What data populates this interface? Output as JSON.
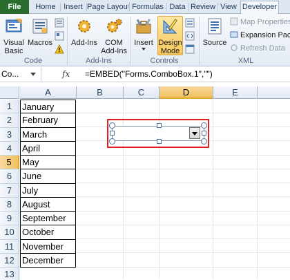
{
  "tabs": [
    {
      "label": "File"
    },
    {
      "label": "Home"
    },
    {
      "label": "Insert"
    },
    {
      "label": "Page Layout"
    },
    {
      "label": "Formulas"
    },
    {
      "label": "Data"
    },
    {
      "label": "Review"
    },
    {
      "label": "View"
    },
    {
      "label": "Developer"
    }
  ],
  "ribbon": {
    "code": {
      "visual_basic": "Visual\nBasic",
      "macros": "Macros",
      "label": "Code"
    },
    "addins": {
      "add_ins": "Add-Ins",
      "com_add_ins": "COM\nAdd-Ins",
      "label": "Add-Ins"
    },
    "controls": {
      "insert": "Insert",
      "design_mode": "Design\nMode",
      "label": "Controls"
    },
    "xml": {
      "source": "Source",
      "map_properties": "Map Properties",
      "expansion_packs": "Expansion Packs",
      "refresh_data": "Refresh Data",
      "label": "XML"
    }
  },
  "formula_bar": {
    "name_box": "Co...",
    "fx": "fx",
    "formula": "=EMBED(\"Forms.ComboBox.1\",\"\")"
  },
  "columns": [
    "A",
    "B",
    "C",
    "D",
    "E"
  ],
  "selected_column": "D",
  "selected_row": "5",
  "rows": [
    {
      "num": "1",
      "value": "January"
    },
    {
      "num": "2",
      "value": "February"
    },
    {
      "num": "3",
      "value": "March"
    },
    {
      "num": "4",
      "value": "April"
    },
    {
      "num": "5",
      "value": "May"
    },
    {
      "num": "6",
      "value": "June"
    },
    {
      "num": "7",
      "value": "July"
    },
    {
      "num": "8",
      "value": "August"
    },
    {
      "num": "9",
      "value": "September"
    },
    {
      "num": "10",
      "value": "October"
    },
    {
      "num": "11",
      "value": "November"
    },
    {
      "num": "12",
      "value": "December"
    },
    {
      "num": "13",
      "value": ""
    }
  ],
  "colors": {
    "file_tab": "#2a6b2e",
    "selection_header": "#f1c15f",
    "highlight_box": "#e02020"
  }
}
